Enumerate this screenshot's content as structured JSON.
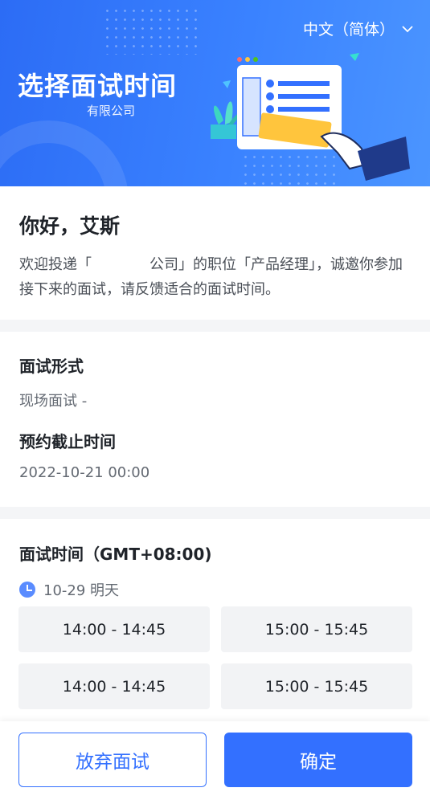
{
  "banner": {
    "title": "选择面试时间",
    "company": "有限公司",
    "language": "中文（简体）"
  },
  "greeting": {
    "title": "你好，艾斯",
    "message": "欢迎投递「　　　　公司」的职位「产品经理」，诚邀你参加接下来的面试，请反馈适合的面试时间。"
  },
  "info": {
    "format_label": "面试形式",
    "format_value": "现场面试 -",
    "deadline_label": "预约截止时间",
    "deadline_value": "2022-10-21 00:00"
  },
  "schedule": {
    "title": "面试时间（GMT+08:00)",
    "date": "10-29 明天",
    "slots": [
      "14:00 - 14:45",
      "15:00 - 15:45",
      "14:00 - 14:45",
      "15:00 - 15:45"
    ]
  },
  "footer": {
    "decline_label": "放弃面试",
    "confirm_label": "确定"
  },
  "colors": {
    "primary": "#3370ff",
    "banner": "#2c6cf5"
  }
}
